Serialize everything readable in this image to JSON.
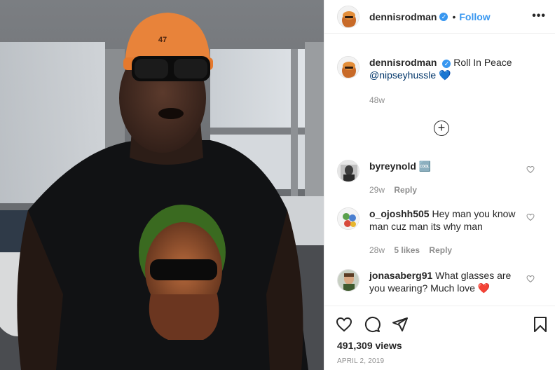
{
  "post": {
    "author": "dennisrodman",
    "follow_label": "Follow",
    "more_label": "•••",
    "caption_user": "dennisrodman",
    "caption_text": "Roll In Peace",
    "caption_mention": "@nipseyhussle",
    "caption_emoji": "💙",
    "caption_age": "48w",
    "load_more_label": "+",
    "views": "491,309 views",
    "date": "APRIL 2, 2019"
  },
  "comments": [
    {
      "user": "byreynold",
      "text": "🆒",
      "age": "29w",
      "likes": "",
      "reply": "Reply"
    },
    {
      "user": "o_ojoshh505",
      "text": "Hey man you know man cuz man its why man",
      "age": "28w",
      "likes": "5 likes",
      "reply": "Reply"
    },
    {
      "user": "jonasaberg91",
      "text": "What glasses are you wearing? Much love",
      "emoji": "❤️",
      "age": "",
      "likes": "",
      "reply": ""
    }
  ],
  "icons": [
    "verified-badge-icon",
    "more-options-icon",
    "add-circle-icon",
    "heart-icon",
    "comment-icon",
    "share-icon",
    "bookmark-icon"
  ],
  "colors": {
    "link": "#3897f0",
    "muted": "#8e8e8e",
    "text": "#262626",
    "like_red": "#ed4956"
  }
}
